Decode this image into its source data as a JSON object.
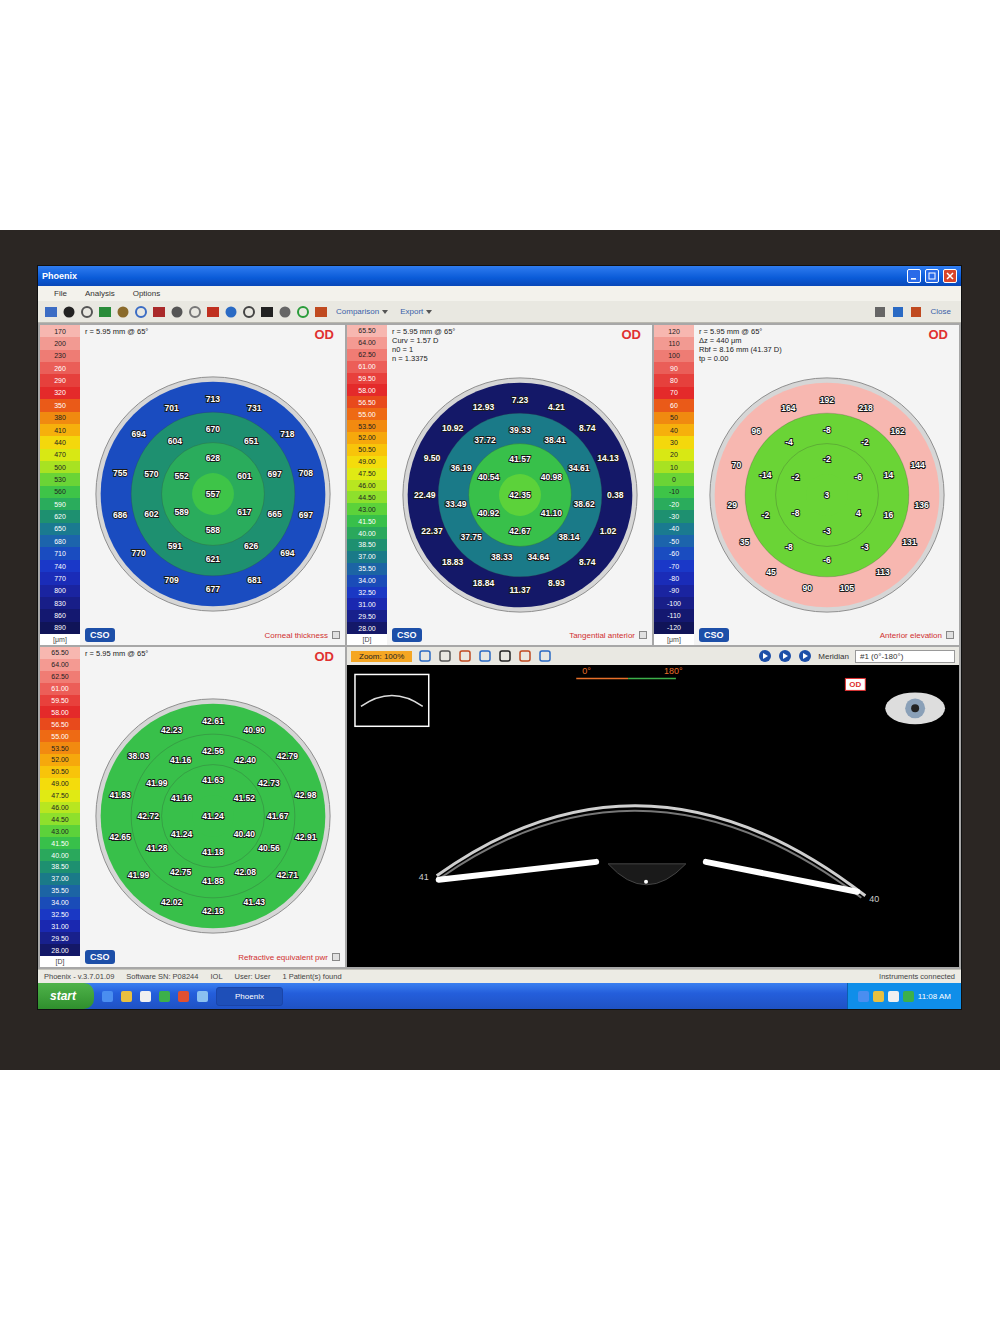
{
  "window": {
    "title": "Phoenix"
  },
  "menu": [
    "File",
    "Analysis",
    "Options"
  ],
  "toolbar": {
    "dropdowns": [
      "Comparison",
      "Export"
    ],
    "close": "Close"
  },
  "logo": "CSO",
  "maps": [
    {
      "label": "Corneal thickness",
      "eye": "OD",
      "unit": "[μm]",
      "info": [
        "r = 5.95 mm @ 65°"
      ],
      "scale": [
        {
          "value": "170",
          "color": "#f7b7b0"
        },
        {
          "value": "200",
          "color": "#f29a92"
        },
        {
          "value": "230",
          "color": "#ee7c74"
        },
        {
          "value": "260",
          "color": "#ea5e58"
        },
        {
          "value": "290",
          "color": "#e6403c"
        },
        {
          "value": "320",
          "color": "#e42a2a"
        },
        {
          "value": "350",
          "color": "#ea5a18"
        },
        {
          "value": "380",
          "color": "#f08a10"
        },
        {
          "value": "410",
          "color": "#f6b00c"
        },
        {
          "value": "440",
          "color": "#f4d80c"
        },
        {
          "value": "470",
          "color": "#d8e814"
        },
        {
          "value": "500",
          "color": "#a8e222"
        },
        {
          "value": "530",
          "color": "#6ad436"
        },
        {
          "value": "560",
          "color": "#3ec448"
        },
        {
          "value": "590",
          "color": "#2aac5c"
        },
        {
          "value": "620",
          "color": "#1e9070"
        },
        {
          "value": "650",
          "color": "#1a7a90"
        },
        {
          "value": "680",
          "color": "#1c64ac"
        },
        {
          "value": "710",
          "color": "#1a4cc0"
        },
        {
          "value": "740",
          "color": "#1a38c8"
        },
        {
          "value": "770",
          "color": "#1a2cb8"
        },
        {
          "value": "800",
          "color": "#1a24a0"
        },
        {
          "value": "830",
          "color": "#181e88"
        },
        {
          "value": "860",
          "color": "#141870"
        },
        {
          "value": "890",
          "color": "#101458"
        }
      ],
      "rings": [
        [
          "557"
        ],
        [
          "628",
          "601",
          "617",
          "588",
          "589",
          "552"
        ],
        [
          "670",
          "651",
          "697",
          "665",
          "626",
          "621",
          "591",
          "602",
          "570",
          "604"
        ],
        [
          "713",
          "731",
          "718",
          "708",
          "697",
          "694",
          "681",
          "677",
          "709",
          "770",
          "686",
          "755",
          "694",
          "701"
        ]
      ]
    },
    {
      "label": "Tangential anterior",
      "eye": "OD",
      "unit": "[D]",
      "info": [
        "r = 5.95 mm @ 65°",
        "Curv = 1.57 D",
        "n0 = 1",
        "n = 1.3375"
      ],
      "scale": [
        {
          "value": "65.50",
          "color": "#f7b7b0"
        },
        {
          "value": "64.00",
          "color": "#f49a92"
        },
        {
          "value": "62.50",
          "color": "#f07c74"
        },
        {
          "value": "61.00",
          "color": "#ec5e58"
        },
        {
          "value": "59.50",
          "color": "#e8403c"
        },
        {
          "value": "58.00",
          "color": "#e42a2a"
        },
        {
          "value": "56.50",
          "color": "#e84a1c"
        },
        {
          "value": "55.00",
          "color": "#ee6a14"
        },
        {
          "value": "53.50",
          "color": "#f28a10"
        },
        {
          "value": "52.00",
          "color": "#f6a80c"
        },
        {
          "value": "50.50",
          "color": "#f8c40a"
        },
        {
          "value": "49.00",
          "color": "#f4dc0c"
        },
        {
          "value": "47.50",
          "color": "#e0ea14"
        },
        {
          "value": "46.00",
          "color": "#b8e620"
        },
        {
          "value": "44.50",
          "color": "#8ee02c"
        },
        {
          "value": "43.00",
          "color": "#5cd23a"
        },
        {
          "value": "41.50",
          "color": "#38c04a"
        },
        {
          "value": "40.00",
          "color": "#2aa85c"
        },
        {
          "value": "38.50",
          "color": "#1e9070"
        },
        {
          "value": "37.00",
          "color": "#1a7a88"
        },
        {
          "value": "35.50",
          "color": "#1c64a4"
        },
        {
          "value": "34.00",
          "color": "#1a4cb8"
        },
        {
          "value": "32.50",
          "color": "#1a38c4"
        },
        {
          "value": "31.00",
          "color": "#1a28b0"
        },
        {
          "value": "29.50",
          "color": "#18208c"
        },
        {
          "value": "28.00",
          "color": "#141868"
        }
      ],
      "rings": [
        [
          "42.35"
        ],
        [
          "41.57",
          "40.98",
          "41.10",
          "42.67",
          "40.92",
          "40.54"
        ],
        [
          "39.33",
          "38.41",
          "34.61",
          "38.62",
          "38.14",
          "34.64",
          "38.33",
          "37.75",
          "33.49",
          "36.19",
          "37.72"
        ],
        [
          "7.23",
          "4.21",
          "8.74",
          "14.13",
          "0.38",
          "1.02",
          "8.74",
          "8.93",
          "11.37",
          "18.84",
          "18.83",
          "22.37",
          "22.49",
          "9.50",
          "10.92",
          "12.93"
        ]
      ]
    },
    {
      "label": "Anterior elevation",
      "eye": "OD",
      "unit": "[μm]",
      "info": [
        "r = 5.95 mm @ 65°",
        "Δz = 440 μm",
        "Rbf = 8.16 mm (41.37 D)",
        "tp = 0.00"
      ],
      "scale": [
        {
          "value": "120",
          "color": "#f7b7b0"
        },
        {
          "value": "110",
          "color": "#f29a92"
        },
        {
          "value": "100",
          "color": "#ee7c74"
        },
        {
          "value": "90",
          "color": "#ea5e58"
        },
        {
          "value": "80",
          "color": "#e6403c"
        },
        {
          "value": "70",
          "color": "#e42a2a"
        },
        {
          "value": "60",
          "color": "#ea5a18"
        },
        {
          "value": "50",
          "color": "#f08a10"
        },
        {
          "value": "40",
          "color": "#f6b00c"
        },
        {
          "value": "30",
          "color": "#f4d80c"
        },
        {
          "value": "20",
          "color": "#d8e814"
        },
        {
          "value": "10",
          "color": "#a8e222"
        },
        {
          "value": "0",
          "color": "#6ad436"
        },
        {
          "value": "-10",
          "color": "#3ec448"
        },
        {
          "value": "-20",
          "color": "#2aac5c"
        },
        {
          "value": "-30",
          "color": "#1e9070"
        },
        {
          "value": "-40",
          "color": "#1a7a90"
        },
        {
          "value": "-50",
          "color": "#1c64ac"
        },
        {
          "value": "-60",
          "color": "#1a4cc0"
        },
        {
          "value": "-70",
          "color": "#1a38c8"
        },
        {
          "value": "-80",
          "color": "#1a2cb8"
        },
        {
          "value": "-90",
          "color": "#1a24a0"
        },
        {
          "value": "-100",
          "color": "#181e88"
        },
        {
          "value": "-110",
          "color": "#141870"
        },
        {
          "value": "-120",
          "color": "#101458"
        }
      ],
      "rings": [
        [
          "3"
        ],
        [
          "-2",
          "-6",
          "4",
          "-3",
          "-8",
          "-2"
        ],
        [
          "-8",
          "-2",
          "14",
          "16",
          "-3",
          "-6",
          "-8",
          "-2",
          "-14",
          "-4"
        ],
        [
          "192",
          "218",
          "162",
          "144",
          "136",
          "131",
          "113",
          "105",
          "90",
          "45",
          "35",
          "29",
          "70",
          "96",
          "164"
        ]
      ]
    },
    {
      "label": "Refractive equivalent pwr",
      "eye": "OD",
      "unit": "[D]",
      "info": [
        "r = 5.95 mm @ 65°"
      ],
      "scale": [
        {
          "value": "65.50",
          "color": "#f7b7b0"
        },
        {
          "value": "64.00",
          "color": "#f49a92"
        },
        {
          "value": "62.50",
          "color": "#f07c74"
        },
        {
          "value": "61.00",
          "color": "#ec5e58"
        },
        {
          "value": "59.50",
          "color": "#e8403c"
        },
        {
          "value": "58.00",
          "color": "#e42a2a"
        },
        {
          "value": "56.50",
          "color": "#e84a1c"
        },
        {
          "value": "55.00",
          "color": "#ee6a14"
        },
        {
          "value": "53.50",
          "color": "#f28a10"
        },
        {
          "value": "52.00",
          "color": "#f6a80c"
        },
        {
          "value": "50.50",
          "color": "#f8c40a"
        },
        {
          "value": "49.00",
          "color": "#f4dc0c"
        },
        {
          "value": "47.50",
          "color": "#e0ea14"
        },
        {
          "value": "46.00",
          "color": "#b8e620"
        },
        {
          "value": "44.50",
          "color": "#8ee02c"
        },
        {
          "value": "43.00",
          "color": "#5cd23a"
        },
        {
          "value": "41.50",
          "color": "#38c04a"
        },
        {
          "value": "40.00",
          "color": "#2aa85c"
        },
        {
          "value": "38.50",
          "color": "#1e9070"
        },
        {
          "value": "37.00",
          "color": "#1a7a88"
        },
        {
          "value": "35.50",
          "color": "#1c64a4"
        },
        {
          "value": "34.00",
          "color": "#1a4cb8"
        },
        {
          "value": "32.50",
          "color": "#1a38c4"
        },
        {
          "value": "31.00",
          "color": "#1a28b0"
        },
        {
          "value": "29.50",
          "color": "#18208c"
        },
        {
          "value": "28.00",
          "color": "#141868"
        }
      ],
      "rings": [
        [
          "41.24"
        ],
        [
          "41.63",
          "41.52",
          "40.40",
          "41.18",
          "41.24",
          "41.16"
        ],
        [
          "42.56",
          "42.40",
          "42.73",
          "41.67",
          "40.56",
          "42.08",
          "41.88",
          "42.75",
          "41.28",
          "42.72",
          "41.99",
          "41.16"
        ],
        [
          "42.61",
          "40.90",
          "42.79",
          "42.98",
          "42.91",
          "42.71",
          "41.43",
          "42.18",
          "42.02",
          "41.99",
          "42.65",
          "41.83",
          "38.03",
          "42.23"
        ]
      ]
    }
  ],
  "scheimpflug": {
    "zoom": "Zoom: 100%",
    "meridian_label": "Meridian",
    "meridian": "#1 (0°-180°)",
    "angles": [
      "0°",
      "180°"
    ],
    "eye": "OD",
    "edge_labels": [
      "41",
      "40"
    ]
  },
  "status_bar": {
    "items": [
      "Phoenix - v.3.7.01.09",
      "Software SN: P08244",
      "IOL",
      "User: User",
      "1 Patient(s) found"
    ],
    "right": "Instruments connected"
  },
  "taskbar": {
    "start": "start",
    "tasks": [
      {
        "label": "Phoenix",
        "selected": true
      }
    ],
    "clock": "11:08 AM"
  }
}
